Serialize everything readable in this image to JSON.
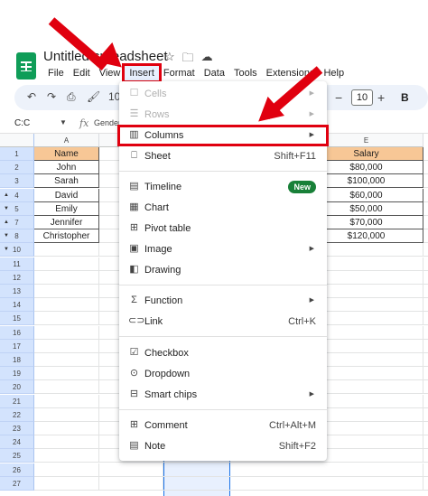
{
  "app": {
    "doc_title": "Untitled spreadsheet"
  },
  "menubar": [
    "File",
    "Edit",
    "View",
    "Insert",
    "Format",
    "Data",
    "Tools",
    "Extensions",
    "Help"
  ],
  "toolbar": {
    "zoom_partial": "10",
    "font_size": "10",
    "bold_label": "B"
  },
  "formula_bar": {
    "name_box": "C:C",
    "fx_label": "fx",
    "content": "Gender"
  },
  "grid": {
    "columns": [
      "A",
      "E"
    ],
    "rows": [
      "1",
      "2",
      "3",
      "4",
      "5",
      "7",
      "8",
      "10",
      "11",
      "12",
      "13",
      "14",
      "15",
      "16",
      "17",
      "18",
      "19",
      "20",
      "21",
      "22",
      "23",
      "24",
      "25",
      "26",
      "27"
    ],
    "col_a": {
      "header": "Name",
      "values": [
        "John",
        "Sarah",
        "David",
        "Emily",
        "Jennifer",
        "Christopher"
      ]
    },
    "col_e": {
      "header": "Salary",
      "values": [
        "$80,000",
        "$100,000",
        "$60,000",
        "$50,000",
        "$70,000",
        "$120,000"
      ]
    }
  },
  "insert_menu": {
    "cells": "Cells",
    "rows": "Rows",
    "columns": "Columns",
    "sheet": "Sheet",
    "sheet_shortcut": "Shift+F11",
    "timeline": "Timeline",
    "timeline_badge": "New",
    "chart": "Chart",
    "pivot_table": "Pivot table",
    "image": "Image",
    "drawing": "Drawing",
    "function": "Function",
    "link": "Link",
    "link_shortcut": "Ctrl+K",
    "checkbox": "Checkbox",
    "dropdown": "Dropdown",
    "smart_chips": "Smart chips",
    "comment": "Comment",
    "comment_shortcut": "Ctrl+Alt+M",
    "note": "Note",
    "note_shortcut": "Shift+F2"
  },
  "colors": {
    "highlight": "#e0000f",
    "header_fill": "#f7c796",
    "selection": "#1a73e8",
    "new_badge": "#188038"
  }
}
